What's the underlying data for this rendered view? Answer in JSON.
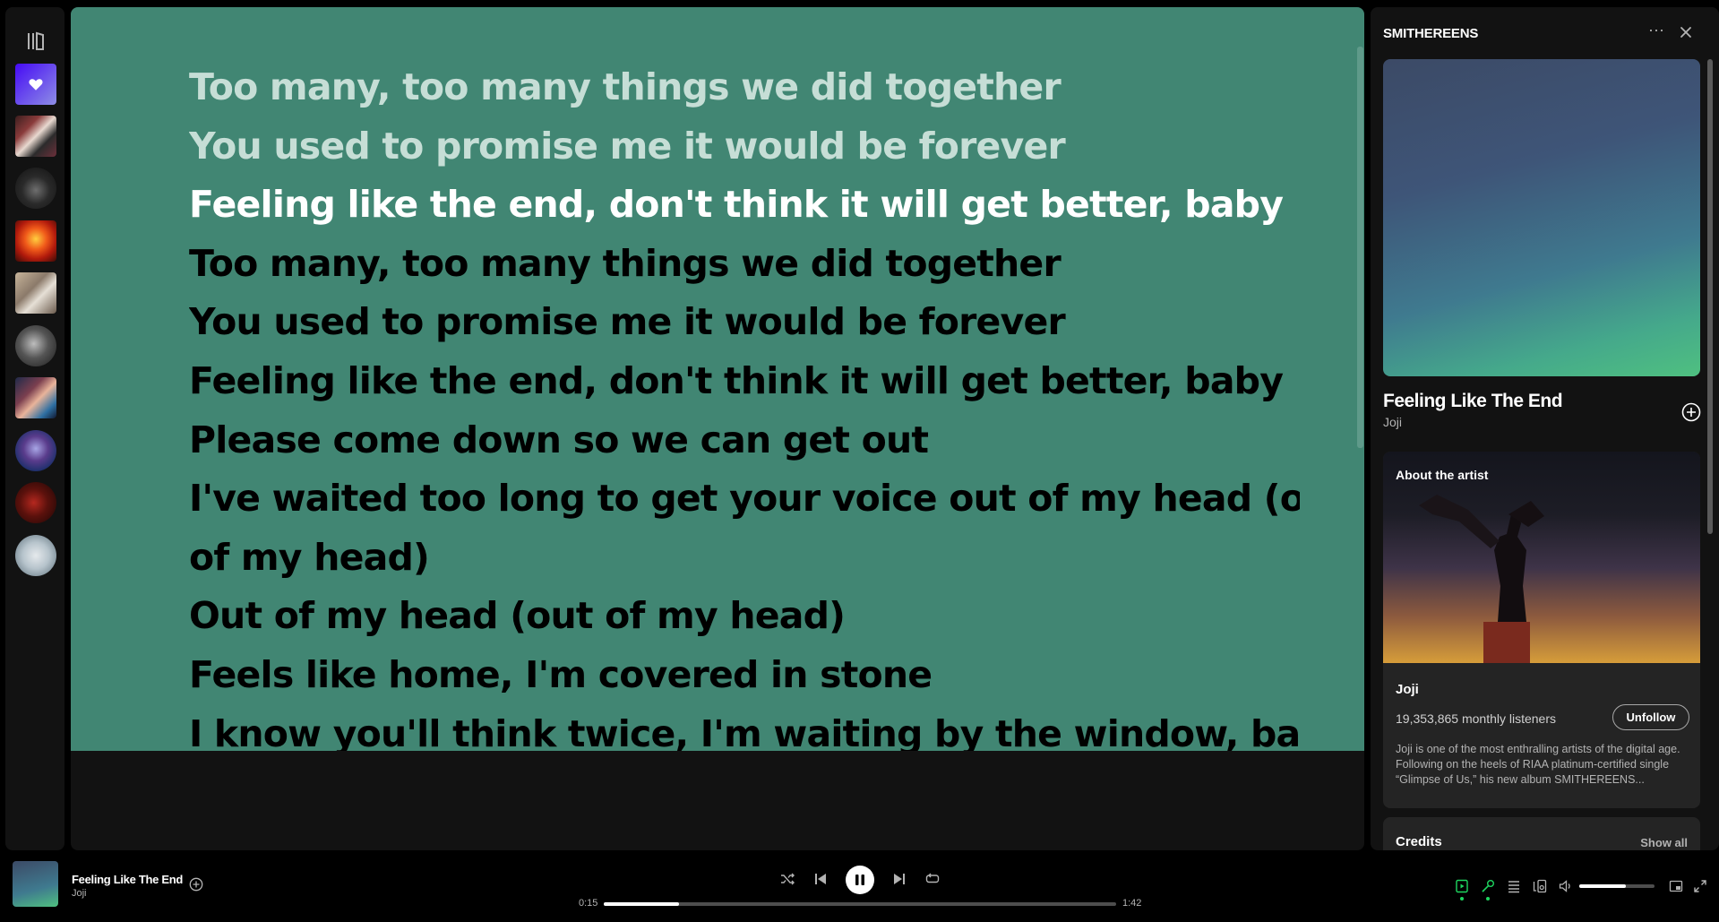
{
  "lyrics": {
    "lines": [
      {
        "text": "Too many, too many things we did together",
        "state": "past"
      },
      {
        "text": "You used to promise me it would be forever",
        "state": "past"
      },
      {
        "text": "Feeling like the end, don't think it will get better, baby",
        "state": "active"
      },
      {
        "text": "Too many, too many things we did together",
        "state": "upcoming"
      },
      {
        "text": "You used to promise me it would be forever",
        "state": "upcoming"
      },
      {
        "text": "Feeling like the end, don't think it will get better, baby",
        "state": "upcoming"
      },
      {
        "text": "Please come down so we can get out",
        "state": "upcoming"
      },
      {
        "text": "I've waited too long to get your voice out of my head (out",
        "state": "upcoming"
      },
      {
        "text": "of my head)",
        "state": "upcoming"
      },
      {
        "text": "Out of my head (out of my head)",
        "state": "upcoming"
      },
      {
        "text": "Feels like home, I'm covered in stone",
        "state": "upcoming"
      },
      {
        "text": "I know you'll think twice, I'm waiting by the window, babe",
        "state": "upcoming"
      }
    ],
    "background_color": "#418673"
  },
  "right_panel": {
    "title": "SMITHEREENS",
    "track_title": "Feeling Like The End",
    "track_artist": "Joji",
    "about_label": "About the artist",
    "artist_name": "Joji",
    "monthly_listeners": "19,353,865 monthly listeners",
    "unfollow_label": "Unfollow",
    "bio": "Joji is one of the most enthralling artists of the digital age. Following on the heels of RIAA platinum-certified single “Glimpse of Us,” his new album SMITHEREENS...",
    "credits_label": "Credits",
    "show_all_label": "Show all"
  },
  "player": {
    "track_title": "Feeling Like The End",
    "track_artist": "Joji",
    "elapsed": "0:15",
    "duration": "1:42",
    "progress": 0.147,
    "volume": 0.62,
    "accent_color": "#1ed760"
  },
  "sidebar": {
    "icons": [
      "library-icon",
      "liked-songs-heart-icon"
    ],
    "items": [
      "playlist-thumb-1",
      "artist-thumb-2",
      "album-thumb-3",
      "playlist-thumb-4",
      "artist-thumb-5",
      "playlist-thumb-6",
      "artist-thumb-7",
      "artist-thumb-8",
      "artist-thumb-9"
    ]
  }
}
